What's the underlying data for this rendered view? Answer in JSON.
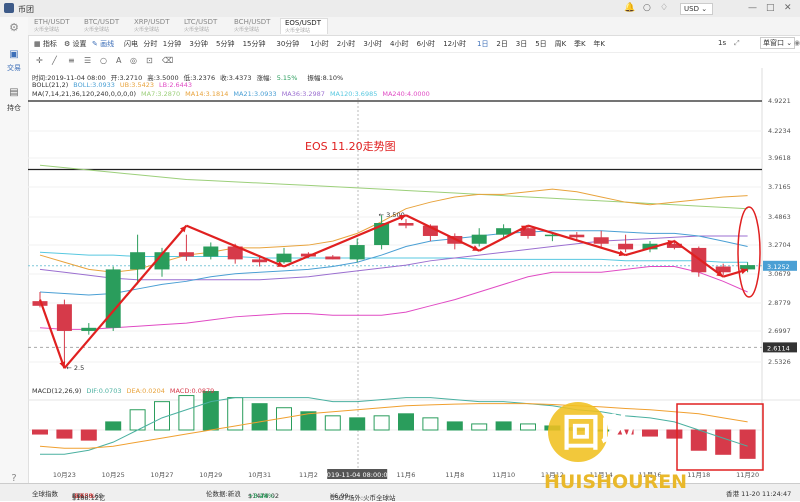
{
  "window": {
    "title": "币团"
  },
  "header": {
    "currency": "USD"
  },
  "tabs": [
    {
      "label": "ETH/USDT",
      "sub": "火币全球站"
    },
    {
      "label": "BTC/USDT",
      "sub": "火币全球站"
    },
    {
      "label": "XRP/USDT",
      "sub": "火币全球站"
    },
    {
      "label": "LTC/USDT",
      "sub": "火币全球站"
    },
    {
      "label": "BCH/USDT",
      "sub": "火币全球站"
    },
    {
      "label": "EOS/USDT",
      "sub": "火币全球站"
    }
  ],
  "sidebar": {
    "items": [
      {
        "label": "交易"
      },
      {
        "label": "持仓"
      }
    ]
  },
  "toolbar": {
    "left": [
      "指标",
      "设置",
      "画线"
    ],
    "periods": [
      "闪电",
      "分时",
      "1分钟",
      "3分钟",
      "5分钟",
      "15分钟",
      "30分钟",
      "1小时",
      "2小时",
      "3小时",
      "4小时",
      "6小时",
      "12小时",
      "1日",
      "2日",
      "3日",
      "5日",
      "周K",
      "季K",
      "年K"
    ],
    "zoom": "1s",
    "mode": "单窗口"
  },
  "ohlc": {
    "time": "时间:2019-11-04 08:00",
    "open": "开:3.2710",
    "high": "高:3.5000",
    "low": "低:3.2376",
    "close": "收:3.4373",
    "change_label": "涨幅:",
    "change": "5.15%",
    "amp": "振幅:8.10%"
  },
  "boll": {
    "label": "BOLL(21,2)",
    "mid": "BOLL:3.0933",
    "ub": "UB:3.5423",
    "lb": "LB:2.6443"
  },
  "ma": {
    "label": "MA(7,14,21,36,120,240,0,0,0,0)",
    "values": [
      "MA7:3.2870",
      "MA14:3.1814",
      "MA21:3.0933",
      "MA36:3.2987",
      "MA120:3.6985",
      "MA240:4.0000"
    ]
  },
  "macd": {
    "label": "MACD(12,26,9)",
    "dif": "DIF:0.0703",
    "dea": "DEA:0.0204",
    "macd": "MACD:0.0879"
  },
  "annotation": "EOS 11.20走势图",
  "bottom": {
    "index": "全球指数",
    "btc_label": "BTC:",
    "btc_price": "$8130.69",
    "btc_change": "-53.53",
    "btc_pct": "-0.65%",
    "btc_vol": "$188.12亿",
    "market": "伦数据:新浪",
    "v2": "$1474.02",
    "v2_change": "+3.48",
    "v2_pct": "+0.24%",
    "exchange": "USDT场外:火币全球站",
    "usdt": "¥6.99",
    "time": "香港 11-20 11:24:47"
  },
  "watermark": {
    "text": "HUISHOUREN",
    "glyphs": "回收"
  },
  "chart_data": {
    "type": "candlestick",
    "title": "EOS 11.20走势图",
    "x": [
      "10-22",
      "10-23",
      "10-24",
      "10-25",
      "10-26",
      "10-27",
      "10-28",
      "10-29",
      "10-30",
      "10-31",
      "11-01",
      "11-02",
      "11-03",
      "11-04",
      "11-05",
      "11-06",
      "11-07",
      "11-08",
      "11-09",
      "11-10",
      "11-11",
      "11-12",
      "11-13",
      "11-14",
      "11-15",
      "11-16",
      "11-17",
      "11-18",
      "11-19",
      "11-20"
    ],
    "xticks": [
      "10月23",
      "10月25",
      "10月27",
      "10月29",
      "10月31",
      "11月2",
      "2019-11-04 08:00:00",
      "11月6",
      "11月8",
      "11月10",
      "11月12",
      "11月14",
      "11月16",
      "11月18",
      "11月20"
    ],
    "candles": [
      {
        "o": 2.89,
        "h": 2.95,
        "l": 2.85,
        "c": 2.86
      },
      {
        "o": 2.87,
        "h": 2.9,
        "l": 2.5,
        "c": 2.7
      },
      {
        "o": 2.7,
        "h": 2.75,
        "l": 2.68,
        "c": 2.72
      },
      {
        "o": 2.72,
        "h": 3.12,
        "l": 2.7,
        "c": 3.1
      },
      {
        "o": 3.1,
        "h": 3.35,
        "l": 3.0,
        "c": 3.22
      },
      {
        "o": 3.1,
        "h": 3.25,
        "l": 3.05,
        "c": 3.22
      },
      {
        "o": 3.22,
        "h": 3.35,
        "l": 3.16,
        "c": 3.19
      },
      {
        "o": 3.19,
        "h": 3.29,
        "l": 3.17,
        "c": 3.26
      },
      {
        "o": 3.26,
        "h": 3.28,
        "l": 3.14,
        "c": 3.17
      },
      {
        "o": 3.17,
        "h": 3.2,
        "l": 3.12,
        "c": 3.15
      },
      {
        "o": 3.15,
        "h": 3.25,
        "l": 3.14,
        "c": 3.21
      },
      {
        "o": 3.21,
        "h": 3.22,
        "l": 3.18,
        "c": 3.19
      },
      {
        "o": 3.19,
        "h": 3.2,
        "l": 3.17,
        "c": 3.17
      },
      {
        "o": 3.17,
        "h": 3.32,
        "l": 3.15,
        "c": 3.27
      },
      {
        "o": 3.27,
        "h": 3.5,
        "l": 3.24,
        "c": 3.44
      },
      {
        "o": 3.44,
        "h": 3.47,
        "l": 3.4,
        "c": 3.42
      },
      {
        "o": 3.42,
        "h": 3.43,
        "l": 3.3,
        "c": 3.34
      },
      {
        "o": 3.34,
        "h": 3.36,
        "l": 3.24,
        "c": 3.28
      },
      {
        "o": 3.28,
        "h": 3.4,
        "l": 3.26,
        "c": 3.35
      },
      {
        "o": 3.35,
        "h": 3.43,
        "l": 3.33,
        "c": 3.4
      },
      {
        "o": 3.4,
        "h": 3.41,
        "l": 3.32,
        "c": 3.34
      },
      {
        "o": 3.34,
        "h": 3.37,
        "l": 3.3,
        "c": 3.35
      },
      {
        "o": 3.35,
        "h": 3.37,
        "l": 3.3,
        "c": 3.33
      },
      {
        "o": 3.33,
        "h": 3.38,
        "l": 3.25,
        "c": 3.28
      },
      {
        "o": 3.28,
        "h": 3.35,
        "l": 3.22,
        "c": 3.24
      },
      {
        "o": 3.24,
        "h": 3.3,
        "l": 3.22,
        "c": 3.28
      },
      {
        "o": 3.28,
        "h": 3.31,
        "l": 3.24,
        "c": 3.25
      },
      {
        "o": 3.25,
        "h": 3.26,
        "l": 3.05,
        "c": 3.08
      },
      {
        "o": 3.12,
        "h": 3.14,
        "l": 3.06,
        "c": 3.08
      },
      {
        "o": 3.1,
        "h": 3.15,
        "l": 3.08,
        "c": 3.13
      }
    ],
    "y_ticks": [
      4.9221,
      4.2234,
      3.9618,
      3.7165,
      3.4863,
      3.2704,
      3.0679,
      2.8779,
      2.6997,
      2.5326
    ],
    "price_marks": {
      "last": 3.1252,
      "low": 2.6114,
      "high_label": "3.500",
      "low_label": "2.5"
    },
    "hlines": [
      4.9221,
      3.8645
    ],
    "lines": {
      "ub": [
        3.2,
        3.15,
        3.1,
        3.08,
        3.1,
        3.15,
        3.2,
        3.22,
        3.25,
        3.25,
        3.26,
        3.27,
        3.3,
        3.36,
        3.45,
        3.55,
        3.6,
        3.64,
        3.66,
        3.66,
        3.68,
        3.7,
        3.68,
        3.64,
        3.6,
        3.58,
        3.6,
        3.62,
        3.64,
        3.65
      ],
      "mid": [
        2.95,
        2.94,
        2.93,
        2.94,
        2.97,
        3.0,
        3.02,
        3.05,
        3.07,
        3.08,
        3.09,
        3.1,
        3.12,
        3.15,
        3.2,
        3.26,
        3.3,
        3.32,
        3.34,
        3.36,
        3.37,
        3.38,
        3.38,
        3.38,
        3.37,
        3.36,
        3.36,
        3.34,
        3.3,
        3.26
      ],
      "lb": [
        2.72,
        2.71,
        2.71,
        2.72,
        2.73,
        2.74,
        2.75,
        2.77,
        2.79,
        2.8,
        2.81,
        2.81,
        2.8,
        2.8,
        2.8,
        2.82,
        2.86,
        2.9,
        2.95,
        3.0,
        3.05,
        3.08,
        3.08,
        3.08,
        3.1,
        3.12,
        3.12,
        3.08,
        3.02,
        2.95
      ],
      "ma120": [
        3.9,
        3.88,
        3.86,
        3.84,
        3.82,
        3.8,
        3.78,
        3.77,
        3.76,
        3.75,
        3.74,
        3.73,
        3.72,
        3.71,
        3.7,
        3.69,
        3.68,
        3.67,
        3.66,
        3.65,
        3.64,
        3.63,
        3.62,
        3.61,
        3.6,
        3.59,
        3.58,
        3.57,
        3.56,
        3.55
      ],
      "ma36": [
        3.1,
        3.08,
        3.06,
        3.04,
        3.03,
        3.03,
        3.03,
        3.03,
        3.03,
        3.03,
        3.04,
        3.05,
        3.07,
        3.09,
        3.11,
        3.13,
        3.16,
        3.18,
        3.2,
        3.22,
        3.24,
        3.26,
        3.28,
        3.3,
        3.31,
        3.32,
        3.33,
        3.34,
        3.34,
        3.34
      ],
      "ma240": [
        3.22,
        3.21,
        3.2,
        3.2,
        3.19,
        3.19,
        3.19,
        3.19,
        3.19,
        3.18,
        3.18,
        3.18,
        3.18,
        3.18,
        3.18,
        3.18,
        3.18,
        3.18,
        3.17,
        3.17,
        3.17,
        3.17,
        3.17,
        3.17,
        3.16,
        3.16,
        3.16,
        3.16,
        3.15,
        3.15
      ]
    },
    "arrows": [
      [
        0,
        2.9
      ],
      [
        1,
        2.5
      ],
      [
        6,
        3.42
      ],
      [
        10,
        3.12
      ],
      [
        15,
        3.5
      ],
      [
        18,
        3.23
      ],
      [
        20,
        3.42
      ],
      [
        24,
        3.2
      ],
      [
        26,
        3.3
      ],
      [
        28,
        3.05
      ],
      [
        29,
        3.1
      ]
    ],
    "macd_hist": [
      -0.01,
      -0.02,
      -0.025,
      0.02,
      0.05,
      0.07,
      0.085,
      0.095,
      0.08,
      0.065,
      0.055,
      0.045,
      0.035,
      0.03,
      0.035,
      0.04,
      0.03,
      0.02,
      0.015,
      0.02,
      0.015,
      0.01,
      0.005,
      0.0,
      -0.01,
      -0.015,
      -0.02,
      -0.05,
      -0.06,
      -0.07
    ],
    "dif": [
      -0.06,
      -0.06,
      -0.05,
      -0.03,
      0.0,
      0.03,
      0.05,
      0.07,
      0.08,
      0.08,
      0.08,
      0.08,
      0.07,
      0.07,
      0.075,
      0.08,
      0.08,
      0.075,
      0.07,
      0.07,
      0.065,
      0.06,
      0.05,
      0.045,
      0.035,
      0.03,
      0.02,
      0.0,
      -0.02,
      -0.04
    ],
    "dea": [
      -0.04,
      -0.045,
      -0.045,
      -0.04,
      -0.03,
      -0.02,
      -0.01,
      0.0,
      0.01,
      0.02,
      0.03,
      0.04,
      0.045,
      0.05,
      0.055,
      0.06,
      0.062,
      0.064,
      0.065,
      0.065,
      0.065,
      0.063,
      0.06,
      0.057,
      0.053,
      0.05,
      0.045,
      0.04,
      0.03,
      0.02
    ],
    "colors": {
      "up": "#2a9d5c",
      "down": "#d63a4a",
      "ub": "#e8a33c",
      "mid": "#4a9fd4",
      "lb": "#e04bc4",
      "ma120": "#9ccf7a",
      "ma36": "#9b6fd0",
      "ma240": "#58c8e0",
      "arrow": "#e02020",
      "dif": "#4ab0a0",
      "dea": "#f0a030"
    }
  }
}
